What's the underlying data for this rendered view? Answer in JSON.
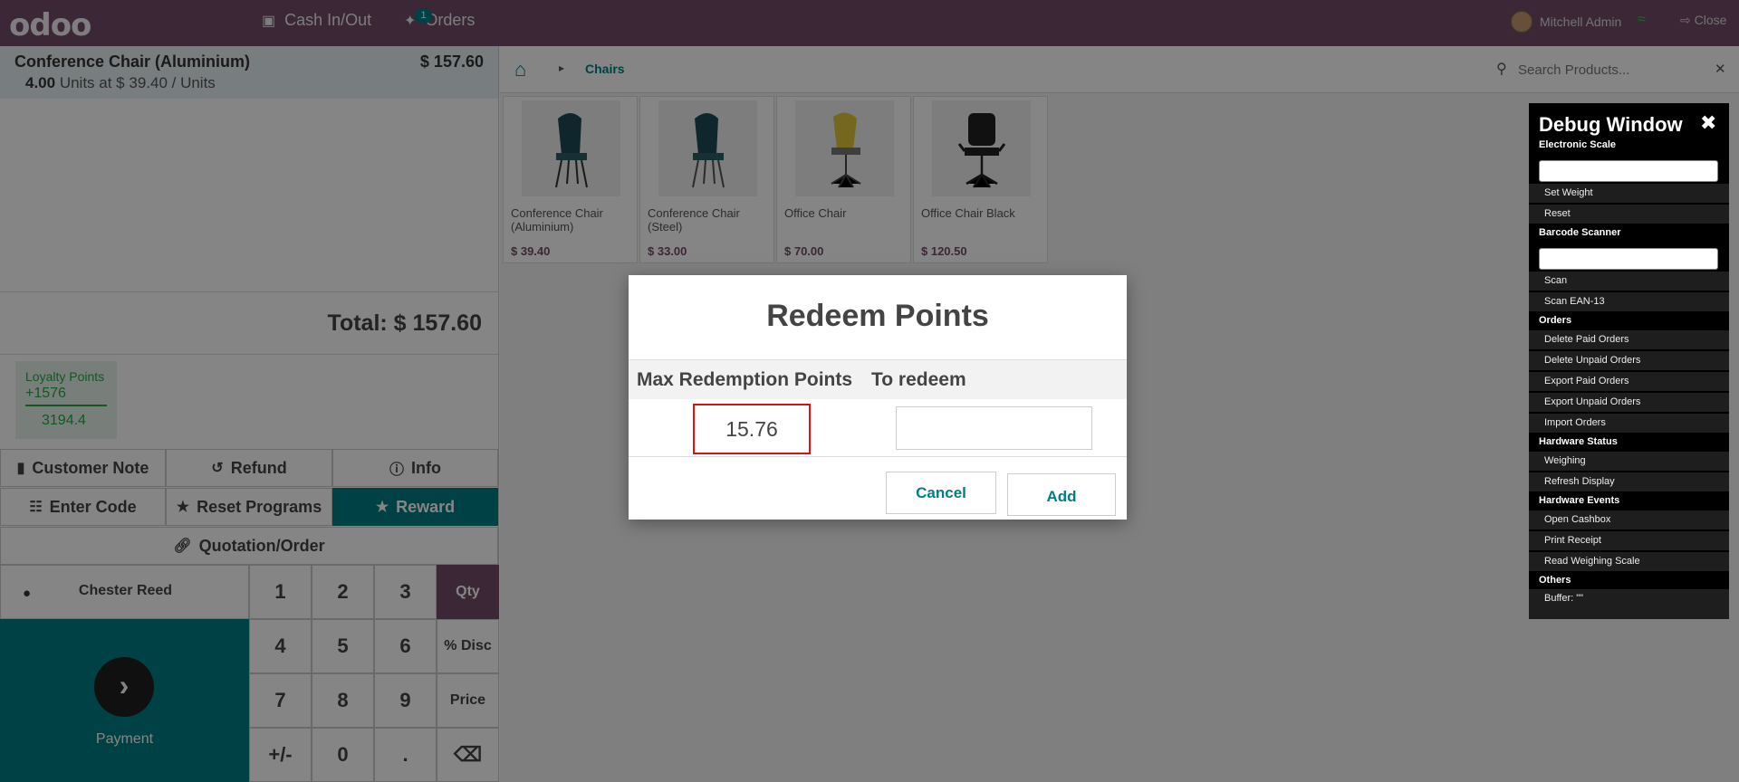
{
  "topbar": {
    "logo": "odoo",
    "cash_label": "Cash In/Out",
    "orders_label": "Orders",
    "orders_count": "1",
    "user_name": "Mitchell Admin",
    "close_label": "Close"
  },
  "order": {
    "line": {
      "name": "Conference Chair (Aluminium)",
      "price": "$ 157.60",
      "qty": "4.00",
      "unit_text": "Units at $ 39.40 / Units"
    },
    "total": "Total: $ 157.60",
    "loyalty": {
      "title": "Loyalty Points",
      "earned": "+1576",
      "balance": "3194.4"
    }
  },
  "controls": {
    "customer_note": "Customer Note",
    "refund": "Refund",
    "info": "Info",
    "enter_code": "Enter Code",
    "reset_programs": "Reset Programs",
    "reward": "Reward",
    "quotation": "Quotation/Order",
    "customer": "Chester Reed",
    "payment": "Payment"
  },
  "numpad": {
    "k1": "1",
    "k2": "2",
    "k3": "3",
    "qty": "Qty",
    "k4": "4",
    "k5": "5",
    "k6": "6",
    "disc": "% Disc",
    "k7": "7",
    "k8": "8",
    "k9": "9",
    "price": "Price",
    "plusminus": "+/-",
    "k0": "0",
    "dot": "."
  },
  "breadcrumb": {
    "category": "Chairs"
  },
  "search": {
    "placeholder": "Search Products..."
  },
  "products": [
    {
      "name": "Conference Chair (Aluminium)",
      "price": "$ 39.40"
    },
    {
      "name": "Conference Chair (Steel)",
      "price": "$ 33.00"
    },
    {
      "name": "Office Chair",
      "price": "$ 70.00"
    },
    {
      "name": "Office Chair Black",
      "price": "$ 120.50"
    }
  ],
  "dialog": {
    "title": "Redeem Points",
    "col_max": "Max Redemption Points",
    "col_redeem": "To redeem",
    "max_value": "15.76",
    "redeem_value": "",
    "cancel": "Cancel",
    "add": "Add"
  },
  "debug": {
    "title": "Debug Window",
    "electronic_scale": "Electronic Scale",
    "set_weight": "Set Weight",
    "reset": "Reset",
    "barcode_scanner": "Barcode Scanner",
    "scan": "Scan",
    "scan_ean": "Scan EAN-13",
    "orders": "Orders",
    "delete_paid": "Delete Paid Orders",
    "delete_unpaid": "Delete Unpaid Orders",
    "export_paid": "Export Paid Orders",
    "export_unpaid": "Export Unpaid Orders",
    "import_orders": "Import Orders",
    "hardware_status": "Hardware Status",
    "weighing": "Weighing",
    "refresh_display": "Refresh Display",
    "hardware_events": "Hardware Events",
    "open_cashbox": "Open Cashbox",
    "print_receipt": "Print Receipt",
    "read_scale": "Read Weighing Scale",
    "others": "Others",
    "buffer": "Buffer: \"\""
  }
}
